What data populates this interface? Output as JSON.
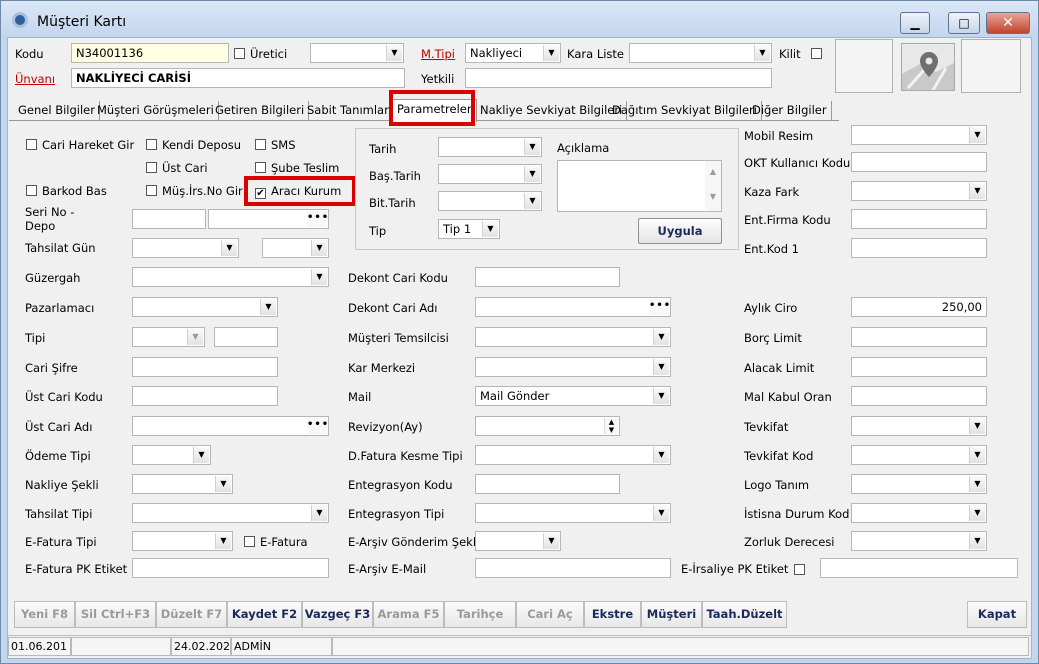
{
  "window": {
    "title": "Müşteri Kartı",
    "btn_min": "▁",
    "btn_max": "□",
    "btn_close": "✕"
  },
  "header": {
    "kodu_label": "Kodu",
    "kodu_value": "N34001136",
    "uretici_label": "Üretici",
    "mtipi_label": "M.Tipi",
    "mtipi_value": "Nakliyeci",
    "kara_liste_label": "Kara Liste",
    "kilit_label": "Kilit",
    "unvani_label": "Ünvanı",
    "unvani_value": "NAKLİYECİ CARİSİ",
    "yetkili_label": "Yetkili"
  },
  "tabs": [
    {
      "label": "Genel Bilgiler"
    },
    {
      "label": "Müşteri Görüşmeleri"
    },
    {
      "label": "Getiren Bilgileri"
    },
    {
      "label": "Sabit Tanımlar"
    },
    {
      "label": "Parametreler"
    },
    {
      "label": "Nakliye Sevkiyat Bilgileri"
    },
    {
      "label": "Dağıtım Sevkiyat Bilgileri"
    },
    {
      "label": "Diğer Bilgiler"
    }
  ],
  "checks": {
    "cari_hareket": "Cari Hareket Gir",
    "kendi_deposu": "Kendi Deposu",
    "sms": "SMS",
    "ust_cari": "Üst Cari",
    "sube_teslim": "Şube Teslim",
    "barkod_bas": "Barkod Bas",
    "mus_irs": "Müş.İrs.No Gir",
    "araci_kurum": "Aracı Kurum",
    "efatura": "E-Fatura"
  },
  "left": {
    "seri_no": "Seri No -",
    "depo": "Depo",
    "tahsilat_gun": "Tahsilat Gün",
    "guzergah": "Güzergah",
    "pazarlamaci": "Pazarlamacı",
    "tipi": "Tipi",
    "cari_sifre": "Cari Şifre",
    "ust_cari_kodu": "Üst Cari Kodu",
    "ust_cari_adi": "Üst Cari Adı",
    "odeme_tipi": "Ödeme Tipi",
    "nakliye_sekli": "Nakliye Şekli",
    "tahsilat_tipi": "Tahsilat Tipi",
    "efatura_tipi": "E-Fatura Tipi",
    "efatura_pk": "E-Fatura PK Etiket"
  },
  "group": {
    "tarih": "Tarih",
    "bas_tarih": "Baş.Tarih",
    "bit_tarih": "Bit.Tarih",
    "tip": "Tip",
    "tip_value": "Tip 1",
    "aciklama": "Açıklama",
    "uygula": "Uygula"
  },
  "middle": {
    "dekont_cari_kodu": "Dekont Cari Kodu",
    "dekont_cari_adi": "Dekont Cari Adı",
    "musteri_temsilcisi": "Müşteri Temsilcisi",
    "kar_merkezi": "Kar Merkezi",
    "mail": "Mail",
    "mail_value": "Mail Gönder",
    "revizyon": "Revizyon(Ay)",
    "d_fatura": "D.Fatura Kesme Tipi",
    "entegrasyon_kodu": "Entegrasyon Kodu",
    "entegrasyon_tipi": "Entegrasyon Tipi",
    "earsiv_gonderim": "E-Arşiv Gönderim Şekli",
    "earsiv_email": "E-Arşiv E-Mail"
  },
  "right": {
    "mobil_resim": "Mobil Resim",
    "okt": "OKT Kullanıcı Kodu",
    "kaza_fark": "Kaza Fark",
    "ent_firma": "Ent.Firma Kodu",
    "ent_kod1": "Ent.Kod 1",
    "aylik_ciro": "Aylık Ciro",
    "aylik_ciro_value": "250,00",
    "borc_limit": "Borç Limit",
    "alacak_limit": "Alacak Limit",
    "mal_kabul": "Mal Kabul Oran",
    "tevkifat": "Tevkifat",
    "tevkifat_kod": "Tevkifat Kod",
    "logo_tanim": "Logo Tanım",
    "istisna": "İstisna Durum Kod",
    "zorluk": "Zorluk Derecesi",
    "eirsaliye_pk": "E-İrsaliye PK Etiket"
  },
  "toolbar": {
    "yeni": "Yeni F8",
    "sil": "Sil Ctrl+F3",
    "duzelt": "Düzelt F7",
    "kaydet": "Kaydet F2",
    "vazgec": "Vazgeç F3",
    "arama": "Arama F5",
    "tarihce": "Tarihçe",
    "cari_ac": "Cari Aç",
    "ekstre": "Ekstre",
    "musteri": "Müşteri",
    "taah": "Taah.Düzelt",
    "kapat": "Kapat"
  },
  "status": {
    "date1": "01.06.201",
    "date2": "24.02.202",
    "user": "ADMİN"
  },
  "icons": {
    "check": "✔",
    "arrow": "▼",
    "dots": "•••",
    "up": "▲",
    "down": "▼",
    "map_pin": "map-pin-icon"
  },
  "colors": {
    "highlight_red": "#dd0000",
    "required_label": "#c00000",
    "kodu_bg": "#ffffe1"
  }
}
